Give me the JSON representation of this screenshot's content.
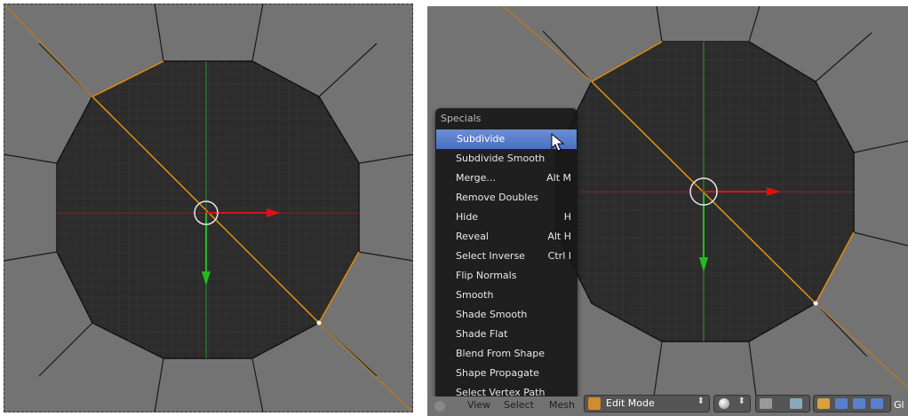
{
  "specials_menu": {
    "title": "Specials",
    "items": [
      {
        "label": "Subdivide",
        "shortcut": ""
      },
      {
        "label": "Subdivide Smooth",
        "shortcut": ""
      },
      {
        "label": "Merge...",
        "shortcut": "Alt M"
      },
      {
        "label": "Remove Doubles",
        "shortcut": ""
      },
      {
        "label": "Hide",
        "shortcut": "H"
      },
      {
        "label": "Reveal",
        "shortcut": "Alt H"
      },
      {
        "label": "Select Inverse",
        "shortcut": "Ctrl I"
      },
      {
        "label": "Flip Normals",
        "shortcut": ""
      },
      {
        "label": "Smooth",
        "shortcut": ""
      },
      {
        "label": "Shade Smooth",
        "shortcut": ""
      },
      {
        "label": "Shade Flat",
        "shortcut": ""
      },
      {
        "label": "Blend From Shape",
        "shortcut": ""
      },
      {
        "label": "Shape Propagate",
        "shortcut": ""
      },
      {
        "label": "Select Vertex Path",
        "shortcut": ""
      }
    ]
  },
  "header": {
    "view": "View",
    "select": "Select",
    "mesh": "Mesh",
    "mode": "Edit Mode",
    "gl": "Gl"
  },
  "colors": {
    "face": "#2c2c2c",
    "outer_face": "#727272",
    "edge_selected": "#e8920e",
    "x_axis": "#dd1111",
    "y_axis": "#22bb22",
    "menu_highlight": "#5a7fcc"
  }
}
